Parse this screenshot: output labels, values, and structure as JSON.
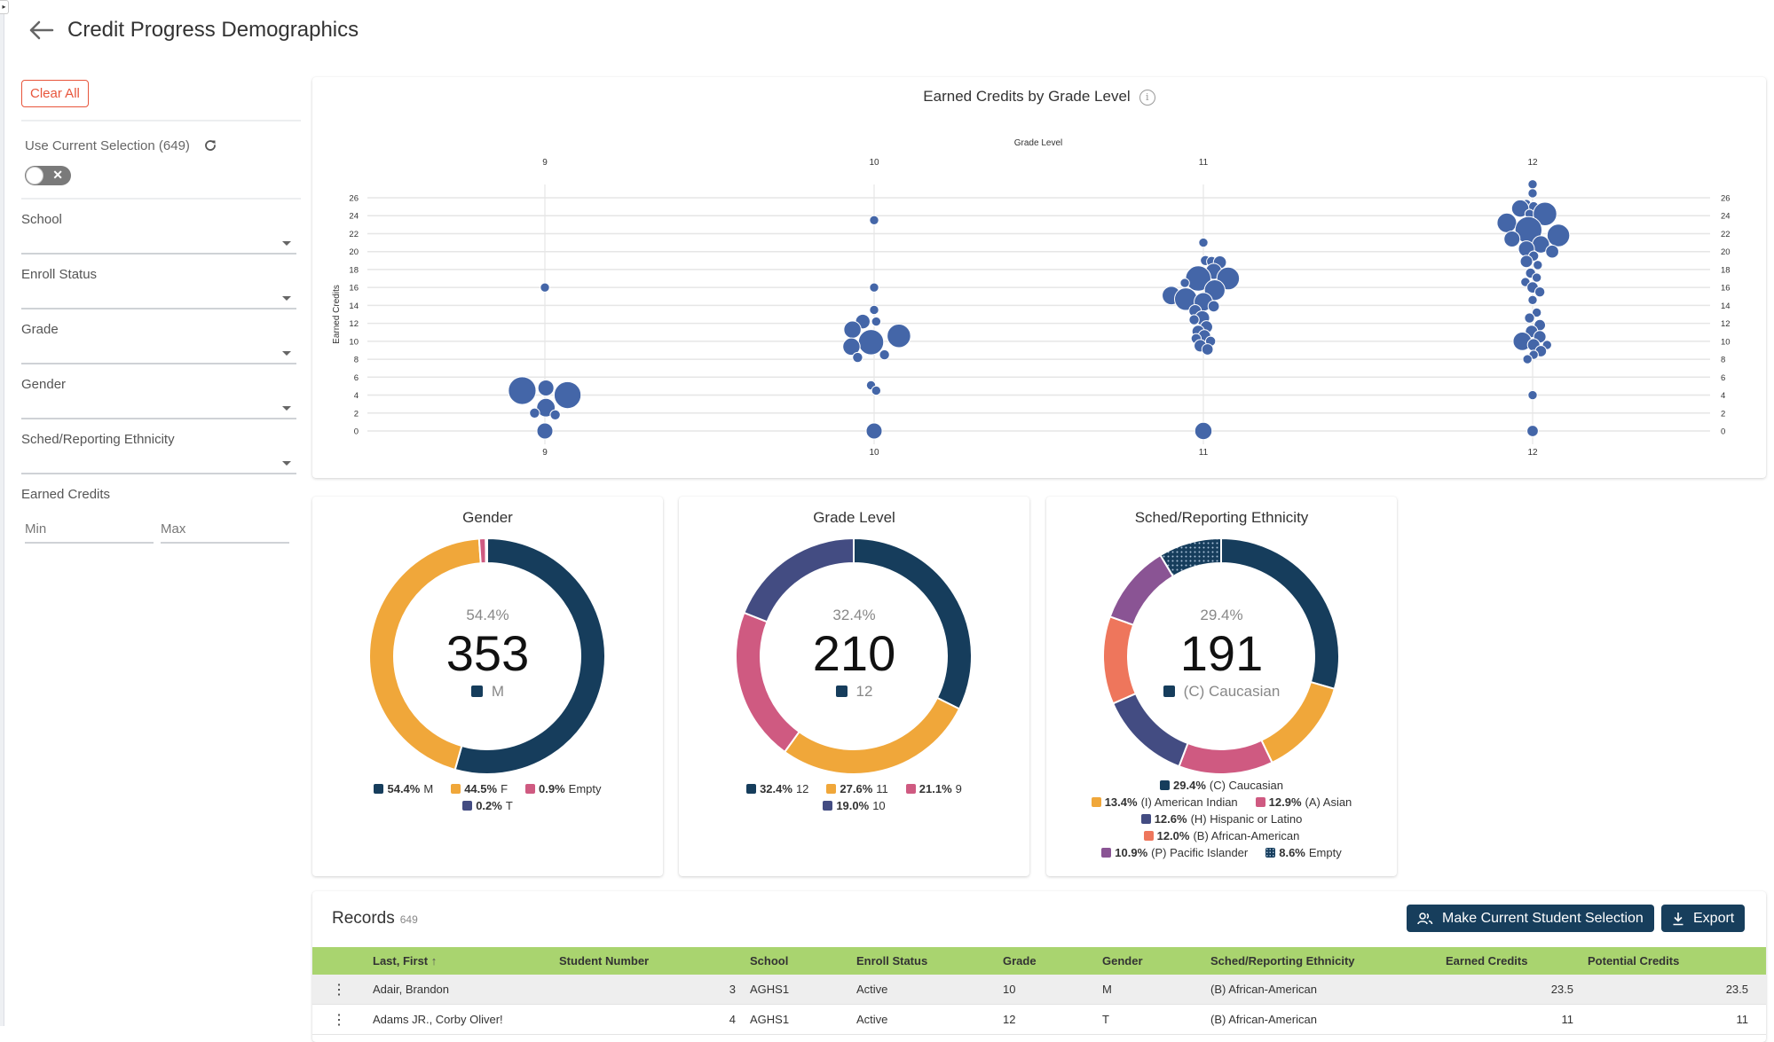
{
  "page": {
    "title": "Credit Progress Demographics",
    "back_icon": "arrow-left-icon"
  },
  "sidebar": {
    "clear_all_label": "Clear All",
    "use_current_selection_label": "Use Current Selection (649)",
    "refresh_icon": "refresh-icon",
    "toggle_on": false,
    "filters": [
      {
        "label": "School",
        "value": ""
      },
      {
        "label": "Enroll Status",
        "value": ""
      },
      {
        "label": "Grade",
        "value": ""
      },
      {
        "label": "Gender",
        "value": ""
      },
      {
        "label": "Sched/Reporting Ethnicity",
        "value": ""
      }
    ],
    "earned_credits": {
      "label": "Earned Credits",
      "min_placeholder": "Min",
      "max_placeholder": "Max",
      "min_value": "",
      "max_value": ""
    }
  },
  "colors": {
    "bubble": "#4466a8",
    "navy": "#163d5c",
    "orange": "#f0a73a",
    "pink": "#cf5a81",
    "indigo": "#434c82",
    "salmon": "#ee765c",
    "purple": "#8a5494",
    "header_green": "#a9d46f",
    "button_dark": "#173e5c",
    "clear_red": "#e8553b"
  },
  "chart_data": [
    {
      "type": "scatter",
      "title": "Earned Credits by Grade Level",
      "xlabel": "Grade Level",
      "ylabel": "Earned Credits",
      "categories": [
        "9",
        "10",
        "11",
        "12"
      ],
      "ylim": [
        0,
        26
      ],
      "yticks": [
        0,
        2,
        4,
        6,
        8,
        10,
        12,
        14,
        16,
        18,
        20,
        22,
        24,
        26
      ],
      "grid": true,
      "note": "bubble (beeswarm) plot; size = student count; dx = horizontal offset within the grade column, in bubble-size units",
      "points": [
        {
          "grade": "9",
          "y": 16,
          "size": 1,
          "dx": 0
        },
        {
          "grade": "9",
          "y": 4.5,
          "size": 9,
          "dx": -2.2
        },
        {
          "grade": "9",
          "y": 4.0,
          "size": 8.5,
          "dx": 2.2
        },
        {
          "grade": "9",
          "y": 4.8,
          "size": 3,
          "dx": 0.1
        },
        {
          "grade": "9",
          "y": 2.6,
          "size": 4,
          "dx": 0.1
        },
        {
          "grade": "9",
          "y": 2.0,
          "size": 1.2,
          "dx": -1.0
        },
        {
          "grade": "9",
          "y": 1.8,
          "size": 1.2,
          "dx": 1.0
        },
        {
          "grade": "9",
          "y": 0,
          "size": 3,
          "dx": 0
        },
        {
          "grade": "10",
          "y": 23.5,
          "size": 1,
          "dx": 0
        },
        {
          "grade": "10",
          "y": 16,
          "size": 1,
          "dx": 0
        },
        {
          "grade": "10",
          "y": 13.5,
          "size": 1,
          "dx": 0
        },
        {
          "grade": "10",
          "y": 12.2,
          "size": 2.5,
          "dx": -1.1
        },
        {
          "grade": "10",
          "y": 12.2,
          "size": 1,
          "dx": 0.2
        },
        {
          "grade": "10",
          "y": 11.3,
          "size": 3.5,
          "dx": -2.1
        },
        {
          "grade": "10",
          "y": 10.6,
          "size": 6.5,
          "dx": 2.4
        },
        {
          "grade": "10",
          "y": 9.9,
          "size": 7.5,
          "dx": -0.3
        },
        {
          "grade": "10",
          "y": 9.4,
          "size": 3.5,
          "dx": -2.2
        },
        {
          "grade": "10",
          "y": 8.5,
          "size": 1.2,
          "dx": 1.0
        },
        {
          "grade": "10",
          "y": 8.2,
          "size": 1.2,
          "dx": -1.6
        },
        {
          "grade": "10",
          "y": 5.1,
          "size": 1,
          "dx": -0.3
        },
        {
          "grade": "10",
          "y": 4.5,
          "size": 1,
          "dx": 0.2
        },
        {
          "grade": "10",
          "y": 0,
          "size": 3,
          "dx": 0
        },
        {
          "grade": "11",
          "y": 21,
          "size": 1,
          "dx": 0
        },
        {
          "grade": "11",
          "y": 19,
          "size": 1.2,
          "dx": 0.2
        },
        {
          "grade": "11",
          "y": 18.9,
          "size": 1.2,
          "dx": 0.8
        },
        {
          "grade": "11",
          "y": 18.8,
          "size": 2,
          "dx": 1.6
        },
        {
          "grade": "11",
          "y": 17.8,
          "size": 3,
          "dx": 1.0
        },
        {
          "grade": "11",
          "y": 17.0,
          "size": 7.5,
          "dx": -0.5
        },
        {
          "grade": "11",
          "y": 17.0,
          "size": 6,
          "dx": 2.4
        },
        {
          "grade": "11",
          "y": 16.5,
          "size": 1,
          "dx": -1.8
        },
        {
          "grade": "11",
          "y": 15.7,
          "size": 5,
          "dx": 1.1
        },
        {
          "grade": "11",
          "y": 15.1,
          "size": 4,
          "dx": -3.1
        },
        {
          "grade": "11",
          "y": 14.7,
          "size": 6,
          "dx": -1.7
        },
        {
          "grade": "11",
          "y": 14.4,
          "size": 4,
          "dx": 0
        },
        {
          "grade": "11",
          "y": 13.9,
          "size": 1.5,
          "dx": 1.0
        },
        {
          "grade": "11",
          "y": 13.4,
          "size": 1.8,
          "dx": -0.8
        },
        {
          "grade": "11",
          "y": 12.6,
          "size": 2.5,
          "dx": -0.1
        },
        {
          "grade": "11",
          "y": 12.4,
          "size": 1.2,
          "dx": -0.9
        },
        {
          "grade": "11",
          "y": 11.6,
          "size": 1.8,
          "dx": 0.3
        },
        {
          "grade": "11",
          "y": 11.1,
          "size": 1.8,
          "dx": -0.5
        },
        {
          "grade": "11",
          "y": 10.6,
          "size": 1.8,
          "dx": 0.1
        },
        {
          "grade": "11",
          "y": 10.3,
          "size": 1.2,
          "dx": -0.7
        },
        {
          "grade": "11",
          "y": 10.0,
          "size": 1.2,
          "dx": 0.7
        },
        {
          "grade": "11",
          "y": 9.5,
          "size": 1.8,
          "dx": -0.3
        },
        {
          "grade": "11",
          "y": 9.1,
          "size": 1.5,
          "dx": 0.4
        },
        {
          "grade": "11",
          "y": 0,
          "size": 3.5,
          "dx": 0
        },
        {
          "grade": "12",
          "y": 27.5,
          "size": 1,
          "dx": 0
        },
        {
          "grade": "12",
          "y": 26.5,
          "size": 1,
          "dx": 0
        },
        {
          "grade": "12",
          "y": 25.3,
          "size": 1,
          "dx": -0.6
        },
        {
          "grade": "12",
          "y": 25.0,
          "size": 1.2,
          "dx": 0.1
        },
        {
          "grade": "12",
          "y": 24.8,
          "size": 3.5,
          "dx": -1.2
        },
        {
          "grade": "12",
          "y": 24.2,
          "size": 1,
          "dx": -0.3
        },
        {
          "grade": "12",
          "y": 24.2,
          "size": 6.5,
          "dx": 1.2
        },
        {
          "grade": "12",
          "y": 23.2,
          "size": 4.5,
          "dx": -2.5
        },
        {
          "grade": "12",
          "y": 22.4,
          "size": 8.5,
          "dx": -0.4
        },
        {
          "grade": "12",
          "y": 21.8,
          "size": 6,
          "dx": 2.5
        },
        {
          "grade": "12",
          "y": 21.4,
          "size": 3,
          "dx": -2.0
        },
        {
          "grade": "12",
          "y": 20.8,
          "size": 3.5,
          "dx": 0.8
        },
        {
          "grade": "12",
          "y": 20.3,
          "size": 3,
          "dx": -0.6
        },
        {
          "grade": "12",
          "y": 20.0,
          "size": 2,
          "dx": 1.9
        },
        {
          "grade": "12",
          "y": 19.5,
          "size": 1.2,
          "dx": 0.1
        },
        {
          "grade": "12",
          "y": 18.9,
          "size": 1.8,
          "dx": -0.6
        },
        {
          "grade": "12",
          "y": 18.5,
          "size": 1,
          "dx": 0.5
        },
        {
          "grade": "12",
          "y": 17.6,
          "size": 1.2,
          "dx": -0.2
        },
        {
          "grade": "12",
          "y": 17.1,
          "size": 1,
          "dx": 0.4
        },
        {
          "grade": "12",
          "y": 16.6,
          "size": 1,
          "dx": -0.7
        },
        {
          "grade": "12",
          "y": 16.0,
          "size": 1.5,
          "dx": 0
        },
        {
          "grade": "12",
          "y": 15.5,
          "size": 1.2,
          "dx": 0.7
        },
        {
          "grade": "12",
          "y": 14.6,
          "size": 1,
          "dx": 0
        },
        {
          "grade": "12",
          "y": 13.2,
          "size": 1,
          "dx": 0.4
        },
        {
          "grade": "12",
          "y": 12.6,
          "size": 1.2,
          "dx": -0.3
        },
        {
          "grade": "12",
          "y": 11.8,
          "size": 1.5,
          "dx": 0.7
        },
        {
          "grade": "12",
          "y": 11.1,
          "size": 1.8,
          "dx": -0.1
        },
        {
          "grade": "12",
          "y": 10.5,
          "size": 1.8,
          "dx": 0.7
        },
        {
          "grade": "12",
          "y": 10.0,
          "size": 4,
          "dx": -1.0
        },
        {
          "grade": "12",
          "y": 9.6,
          "size": 1.8,
          "dx": 0.1
        },
        {
          "grade": "12",
          "y": 9.6,
          "size": 1,
          "dx": 1.4
        },
        {
          "grade": "12",
          "y": 8.9,
          "size": 1.5,
          "dx": 0.8
        },
        {
          "grade": "12",
          "y": 8.5,
          "size": 1,
          "dx": 0.1
        },
        {
          "grade": "12",
          "y": 8.0,
          "size": 1,
          "dx": -0.5
        },
        {
          "grade": "12",
          "y": 4,
          "size": 1,
          "dx": 0
        },
        {
          "grade": "12",
          "y": 0,
          "size": 1.5,
          "dx": 0
        }
      ]
    },
    {
      "type": "pie",
      "title": "Gender",
      "center": {
        "pct": "54.4%",
        "count": "353",
        "label": "M",
        "color": "#163d5c"
      },
      "slices": [
        {
          "label": "M",
          "value": 54.4,
          "color": "#163d5c"
        },
        {
          "label": "F",
          "value": 44.5,
          "color": "#f0a73a"
        },
        {
          "label": "Empty",
          "value": 0.9,
          "color": "#cf5a81"
        },
        {
          "label": "T",
          "value": 0.2,
          "color": "#434c82"
        }
      ],
      "legend_rows": [
        [
          0,
          1,
          2
        ],
        [
          3
        ]
      ]
    },
    {
      "type": "pie",
      "title": "Grade Level",
      "center": {
        "pct": "32.4%",
        "count": "210",
        "label": "12",
        "color": "#163d5c"
      },
      "slices": [
        {
          "label": "12",
          "value": 32.4,
          "color": "#163d5c"
        },
        {
          "label": "11",
          "value": 27.6,
          "color": "#f0a73a"
        },
        {
          "label": "9",
          "value": 21.1,
          "color": "#cf5a81"
        },
        {
          "label": "10",
          "value": 19.0,
          "color": "#434c82"
        }
      ],
      "legend_rows": [
        [
          0,
          1,
          2
        ],
        [
          3
        ]
      ]
    },
    {
      "type": "pie",
      "title": "Sched/Reporting Ethnicity",
      "center": {
        "pct": "29.4%",
        "count": "191",
        "label": "(C) Caucasian",
        "color": "#163d5c"
      },
      "slices": [
        {
          "label": "(C) Caucasian",
          "value": 29.4,
          "color": "#163d5c"
        },
        {
          "label": "(I) American Indian",
          "value": 13.4,
          "color": "#f0a73a"
        },
        {
          "label": "(A) Asian",
          "value": 12.9,
          "color": "#cf5a81"
        },
        {
          "label": "(H) Hispanic or Latino",
          "value": 12.6,
          "color": "#434c82"
        },
        {
          "label": "(B) African-American",
          "value": 12.0,
          "color": "#ee765c"
        },
        {
          "label": "(P) Pacific Islander",
          "value": 10.9,
          "color": "#8a5494"
        },
        {
          "label": "Empty",
          "value": 8.6,
          "color": "#163d5c",
          "pattern": "dots"
        }
      ],
      "legend_rows": [
        [
          0
        ],
        [
          1,
          2
        ],
        [
          3
        ],
        [
          4
        ],
        [
          5,
          6
        ]
      ]
    }
  ],
  "records": {
    "title": "Records",
    "count": "649",
    "make_selection_label": "Make Current Student Selection",
    "export_label": "Export",
    "columns": [
      {
        "label": "",
        "align": "left"
      },
      {
        "label": "Last, First",
        "align": "left",
        "sort": "asc"
      },
      {
        "label": "Student Number",
        "align": "left"
      },
      {
        "label": "School",
        "align": "left"
      },
      {
        "label": "Enroll Status",
        "align": "left"
      },
      {
        "label": "Grade",
        "align": "left"
      },
      {
        "label": "Gender",
        "align": "left"
      },
      {
        "label": "Sched/Reporting Ethnicity",
        "align": "left"
      },
      {
        "label": "Earned Credits",
        "align": "left"
      },
      {
        "label": "Potential Credits",
        "align": "left"
      }
    ],
    "rows": [
      {
        "name": "Adair, Brandon",
        "student_number": "3",
        "school": "AGHS1",
        "enroll_status": "Active",
        "grade": "10",
        "gender": "M",
        "ethnicity": "(B) African-American",
        "earned": "23.5",
        "potential": "23.5"
      },
      {
        "name": "Adams JR., Corby Oliver!",
        "student_number": "4",
        "school": "AGHS1",
        "enroll_status": "Active",
        "grade": "12",
        "gender": "T",
        "ethnicity": "(B) African-American",
        "earned": "11",
        "potential": "11"
      }
    ]
  }
}
